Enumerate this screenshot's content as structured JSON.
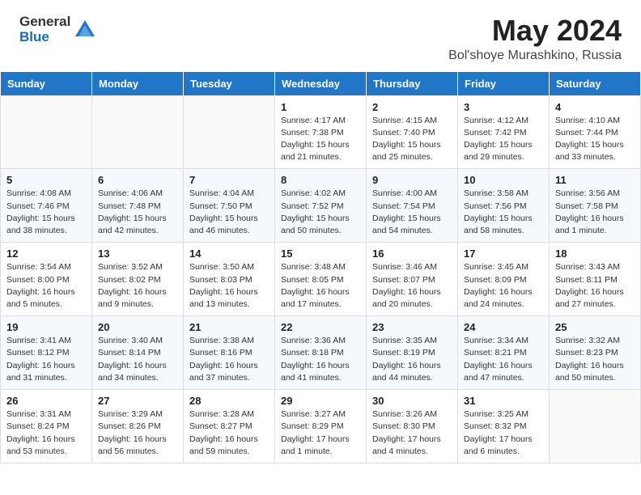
{
  "header": {
    "logo_general": "General",
    "logo_blue": "Blue",
    "title": "May 2024",
    "location": "Bol'shoye Murashkino, Russia"
  },
  "days_of_week": [
    "Sunday",
    "Monday",
    "Tuesday",
    "Wednesday",
    "Thursday",
    "Friday",
    "Saturday"
  ],
  "weeks": [
    [
      {
        "day": "",
        "info": ""
      },
      {
        "day": "",
        "info": ""
      },
      {
        "day": "",
        "info": ""
      },
      {
        "day": "1",
        "info": "Sunrise: 4:17 AM\nSunset: 7:38 PM\nDaylight: 15 hours\nand 21 minutes."
      },
      {
        "day": "2",
        "info": "Sunrise: 4:15 AM\nSunset: 7:40 PM\nDaylight: 15 hours\nand 25 minutes."
      },
      {
        "day": "3",
        "info": "Sunrise: 4:12 AM\nSunset: 7:42 PM\nDaylight: 15 hours\nand 29 minutes."
      },
      {
        "day": "4",
        "info": "Sunrise: 4:10 AM\nSunset: 7:44 PM\nDaylight: 15 hours\nand 33 minutes."
      }
    ],
    [
      {
        "day": "5",
        "info": "Sunrise: 4:08 AM\nSunset: 7:46 PM\nDaylight: 15 hours\nand 38 minutes."
      },
      {
        "day": "6",
        "info": "Sunrise: 4:06 AM\nSunset: 7:48 PM\nDaylight: 15 hours\nand 42 minutes."
      },
      {
        "day": "7",
        "info": "Sunrise: 4:04 AM\nSunset: 7:50 PM\nDaylight: 15 hours\nand 46 minutes."
      },
      {
        "day": "8",
        "info": "Sunrise: 4:02 AM\nSunset: 7:52 PM\nDaylight: 15 hours\nand 50 minutes."
      },
      {
        "day": "9",
        "info": "Sunrise: 4:00 AM\nSunset: 7:54 PM\nDaylight: 15 hours\nand 54 minutes."
      },
      {
        "day": "10",
        "info": "Sunrise: 3:58 AM\nSunset: 7:56 PM\nDaylight: 15 hours\nand 58 minutes."
      },
      {
        "day": "11",
        "info": "Sunrise: 3:56 AM\nSunset: 7:58 PM\nDaylight: 16 hours\nand 1 minute."
      }
    ],
    [
      {
        "day": "12",
        "info": "Sunrise: 3:54 AM\nSunset: 8:00 PM\nDaylight: 16 hours\nand 5 minutes."
      },
      {
        "day": "13",
        "info": "Sunrise: 3:52 AM\nSunset: 8:02 PM\nDaylight: 16 hours\nand 9 minutes."
      },
      {
        "day": "14",
        "info": "Sunrise: 3:50 AM\nSunset: 8:03 PM\nDaylight: 16 hours\nand 13 minutes."
      },
      {
        "day": "15",
        "info": "Sunrise: 3:48 AM\nSunset: 8:05 PM\nDaylight: 16 hours\nand 17 minutes."
      },
      {
        "day": "16",
        "info": "Sunrise: 3:46 AM\nSunset: 8:07 PM\nDaylight: 16 hours\nand 20 minutes."
      },
      {
        "day": "17",
        "info": "Sunrise: 3:45 AM\nSunset: 8:09 PM\nDaylight: 16 hours\nand 24 minutes."
      },
      {
        "day": "18",
        "info": "Sunrise: 3:43 AM\nSunset: 8:11 PM\nDaylight: 16 hours\nand 27 minutes."
      }
    ],
    [
      {
        "day": "19",
        "info": "Sunrise: 3:41 AM\nSunset: 8:12 PM\nDaylight: 16 hours\nand 31 minutes."
      },
      {
        "day": "20",
        "info": "Sunrise: 3:40 AM\nSunset: 8:14 PM\nDaylight: 16 hours\nand 34 minutes."
      },
      {
        "day": "21",
        "info": "Sunrise: 3:38 AM\nSunset: 8:16 PM\nDaylight: 16 hours\nand 37 minutes."
      },
      {
        "day": "22",
        "info": "Sunrise: 3:36 AM\nSunset: 8:18 PM\nDaylight: 16 hours\nand 41 minutes."
      },
      {
        "day": "23",
        "info": "Sunrise: 3:35 AM\nSunset: 8:19 PM\nDaylight: 16 hours\nand 44 minutes."
      },
      {
        "day": "24",
        "info": "Sunrise: 3:34 AM\nSunset: 8:21 PM\nDaylight: 16 hours\nand 47 minutes."
      },
      {
        "day": "25",
        "info": "Sunrise: 3:32 AM\nSunset: 8:23 PM\nDaylight: 16 hours\nand 50 minutes."
      }
    ],
    [
      {
        "day": "26",
        "info": "Sunrise: 3:31 AM\nSunset: 8:24 PM\nDaylight: 16 hours\nand 53 minutes."
      },
      {
        "day": "27",
        "info": "Sunrise: 3:29 AM\nSunset: 8:26 PM\nDaylight: 16 hours\nand 56 minutes."
      },
      {
        "day": "28",
        "info": "Sunrise: 3:28 AM\nSunset: 8:27 PM\nDaylight: 16 hours\nand 59 minutes."
      },
      {
        "day": "29",
        "info": "Sunrise: 3:27 AM\nSunset: 8:29 PM\nDaylight: 17 hours\nand 1 minute."
      },
      {
        "day": "30",
        "info": "Sunrise: 3:26 AM\nSunset: 8:30 PM\nDaylight: 17 hours\nand 4 minutes."
      },
      {
        "day": "31",
        "info": "Sunrise: 3:25 AM\nSunset: 8:32 PM\nDaylight: 17 hours\nand 6 minutes."
      },
      {
        "day": "",
        "info": ""
      }
    ]
  ]
}
